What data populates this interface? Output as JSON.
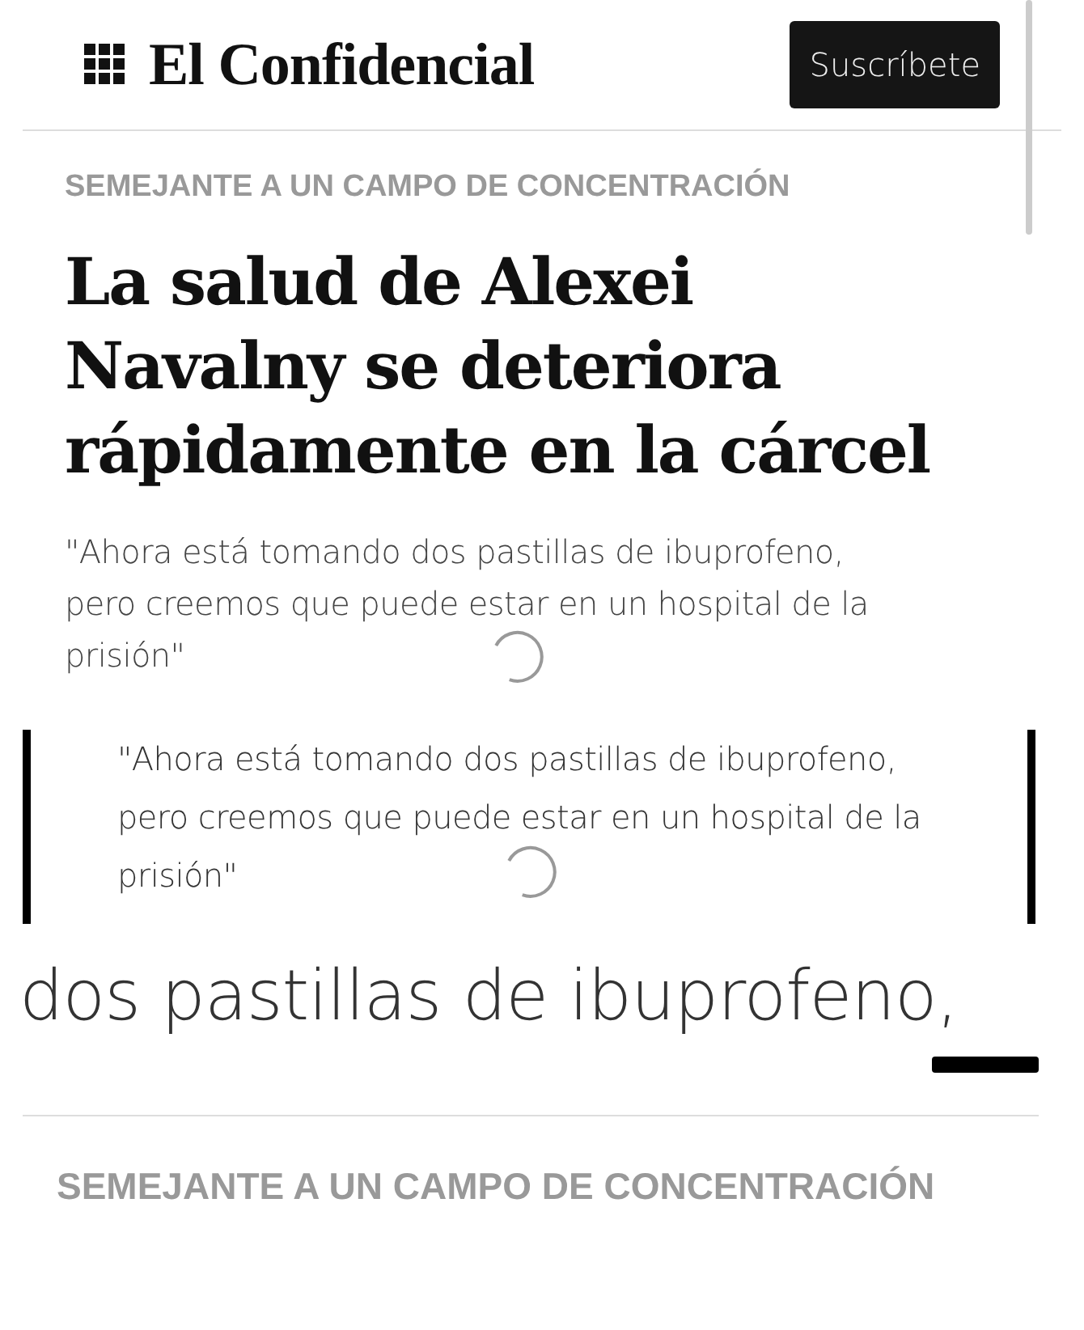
{
  "header": {
    "logo": "El Confidencial",
    "subscribe_button": "Suscríbete"
  },
  "article": {
    "kicker": "SEMEJANTE A UN CAMPO DE CONCENTRACIÓN",
    "headline": "La salud de Alexei Navalny se deteriora rápidamente en la cárcel",
    "subtitle": "\"Ahora está tomando dos pastillas de ibuprofeno, pero creemos que puede estar en un hospital de la prisión\"",
    "loading": true
  },
  "quote": {
    "text": "\"Ahora está tomando dos pastillas de ibuprofeno, pero creemos que puede estar en un hospital de la prisión\"",
    "loading": true
  },
  "zoomed_text": "dos pastillas de ibuprofeno,",
  "footer_kicker": "SEMEJANTE A UN CAMPO DE CONCENTRACIÓN"
}
